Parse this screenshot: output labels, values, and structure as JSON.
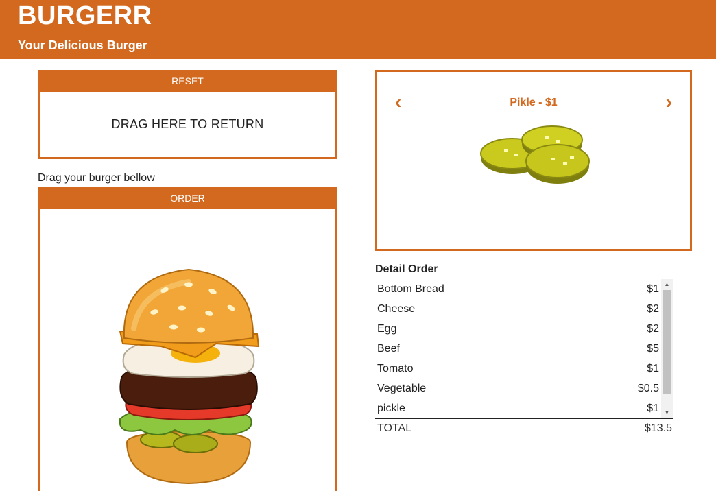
{
  "header": {
    "title": "BURGERR",
    "subtitle": "Your Delicious Burger"
  },
  "reset": {
    "button_label": "RESET",
    "drop_label": "DRAG HERE TO RETURN"
  },
  "order": {
    "hint": "Drag your burger bellow",
    "button_label": "ORDER"
  },
  "carousel": {
    "item_label": "Pikle - $1",
    "prev_icon": "chevron-left-icon",
    "next_icon": "chevron-right-icon"
  },
  "detail": {
    "title": "Detail Order",
    "items": [
      {
        "name": "Bottom Bread",
        "price": "$1"
      },
      {
        "name": "Cheese",
        "price": "$2"
      },
      {
        "name": "Egg",
        "price": "$2"
      },
      {
        "name": "Beef",
        "price": "$5"
      },
      {
        "name": "Tomato",
        "price": "$1"
      },
      {
        "name": "Vegetable",
        "price": "$0.5"
      },
      {
        "name": "pickle",
        "price": "$1"
      }
    ],
    "total_label": "TOTAL",
    "total_value": "$13.5"
  },
  "colors": {
    "brand": "#d2691e",
    "bun": "#e8a13a",
    "pickle": "#c8c820"
  }
}
